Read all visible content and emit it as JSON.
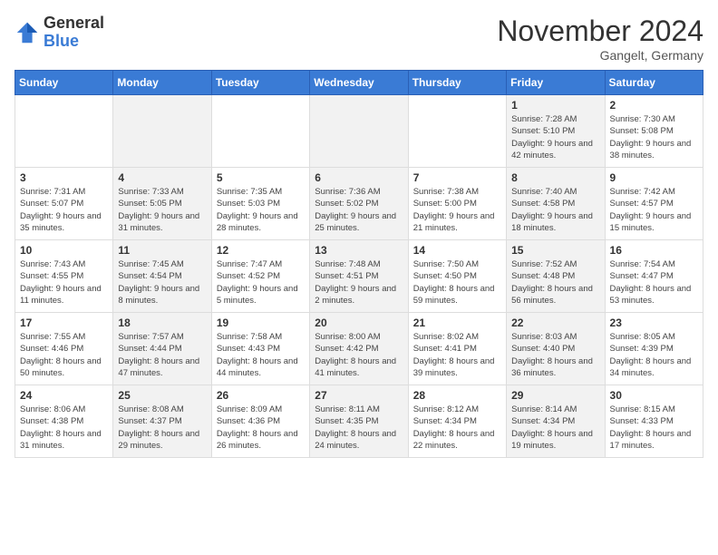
{
  "header": {
    "logo_general": "General",
    "logo_blue": "Blue",
    "month": "November 2024",
    "location": "Gangelt, Germany"
  },
  "weekdays": [
    "Sunday",
    "Monday",
    "Tuesday",
    "Wednesday",
    "Thursday",
    "Friday",
    "Saturday"
  ],
  "weeks": [
    [
      {
        "day": "",
        "text": ""
      },
      {
        "day": "",
        "text": ""
      },
      {
        "day": "",
        "text": ""
      },
      {
        "day": "",
        "text": ""
      },
      {
        "day": "",
        "text": ""
      },
      {
        "day": "1",
        "text": "Sunrise: 7:28 AM\nSunset: 5:10 PM\nDaylight: 9 hours and 42 minutes."
      },
      {
        "day": "2",
        "text": "Sunrise: 7:30 AM\nSunset: 5:08 PM\nDaylight: 9 hours and 38 minutes."
      }
    ],
    [
      {
        "day": "3",
        "text": "Sunrise: 7:31 AM\nSunset: 5:07 PM\nDaylight: 9 hours and 35 minutes."
      },
      {
        "day": "4",
        "text": "Sunrise: 7:33 AM\nSunset: 5:05 PM\nDaylight: 9 hours and 31 minutes."
      },
      {
        "day": "5",
        "text": "Sunrise: 7:35 AM\nSunset: 5:03 PM\nDaylight: 9 hours and 28 minutes."
      },
      {
        "day": "6",
        "text": "Sunrise: 7:36 AM\nSunset: 5:02 PM\nDaylight: 9 hours and 25 minutes."
      },
      {
        "day": "7",
        "text": "Sunrise: 7:38 AM\nSunset: 5:00 PM\nDaylight: 9 hours and 21 minutes."
      },
      {
        "day": "8",
        "text": "Sunrise: 7:40 AM\nSunset: 4:58 PM\nDaylight: 9 hours and 18 minutes."
      },
      {
        "day": "9",
        "text": "Sunrise: 7:42 AM\nSunset: 4:57 PM\nDaylight: 9 hours and 15 minutes."
      }
    ],
    [
      {
        "day": "10",
        "text": "Sunrise: 7:43 AM\nSunset: 4:55 PM\nDaylight: 9 hours and 11 minutes."
      },
      {
        "day": "11",
        "text": "Sunrise: 7:45 AM\nSunset: 4:54 PM\nDaylight: 9 hours and 8 minutes."
      },
      {
        "day": "12",
        "text": "Sunrise: 7:47 AM\nSunset: 4:52 PM\nDaylight: 9 hours and 5 minutes."
      },
      {
        "day": "13",
        "text": "Sunrise: 7:48 AM\nSunset: 4:51 PM\nDaylight: 9 hours and 2 minutes."
      },
      {
        "day": "14",
        "text": "Sunrise: 7:50 AM\nSunset: 4:50 PM\nDaylight: 8 hours and 59 minutes."
      },
      {
        "day": "15",
        "text": "Sunrise: 7:52 AM\nSunset: 4:48 PM\nDaylight: 8 hours and 56 minutes."
      },
      {
        "day": "16",
        "text": "Sunrise: 7:54 AM\nSunset: 4:47 PM\nDaylight: 8 hours and 53 minutes."
      }
    ],
    [
      {
        "day": "17",
        "text": "Sunrise: 7:55 AM\nSunset: 4:46 PM\nDaylight: 8 hours and 50 minutes."
      },
      {
        "day": "18",
        "text": "Sunrise: 7:57 AM\nSunset: 4:44 PM\nDaylight: 8 hours and 47 minutes."
      },
      {
        "day": "19",
        "text": "Sunrise: 7:58 AM\nSunset: 4:43 PM\nDaylight: 8 hours and 44 minutes."
      },
      {
        "day": "20",
        "text": "Sunrise: 8:00 AM\nSunset: 4:42 PM\nDaylight: 8 hours and 41 minutes."
      },
      {
        "day": "21",
        "text": "Sunrise: 8:02 AM\nSunset: 4:41 PM\nDaylight: 8 hours and 39 minutes."
      },
      {
        "day": "22",
        "text": "Sunrise: 8:03 AM\nSunset: 4:40 PM\nDaylight: 8 hours and 36 minutes."
      },
      {
        "day": "23",
        "text": "Sunrise: 8:05 AM\nSunset: 4:39 PM\nDaylight: 8 hours and 34 minutes."
      }
    ],
    [
      {
        "day": "24",
        "text": "Sunrise: 8:06 AM\nSunset: 4:38 PM\nDaylight: 8 hours and 31 minutes."
      },
      {
        "day": "25",
        "text": "Sunrise: 8:08 AM\nSunset: 4:37 PM\nDaylight: 8 hours and 29 minutes."
      },
      {
        "day": "26",
        "text": "Sunrise: 8:09 AM\nSunset: 4:36 PM\nDaylight: 8 hours and 26 minutes."
      },
      {
        "day": "27",
        "text": "Sunrise: 8:11 AM\nSunset: 4:35 PM\nDaylight: 8 hours and 24 minutes."
      },
      {
        "day": "28",
        "text": "Sunrise: 8:12 AM\nSunset: 4:34 PM\nDaylight: 8 hours and 22 minutes."
      },
      {
        "day": "29",
        "text": "Sunrise: 8:14 AM\nSunset: 4:34 PM\nDaylight: 8 hours and 19 minutes."
      },
      {
        "day": "30",
        "text": "Sunrise: 8:15 AM\nSunset: 4:33 PM\nDaylight: 8 hours and 17 minutes."
      }
    ]
  ]
}
